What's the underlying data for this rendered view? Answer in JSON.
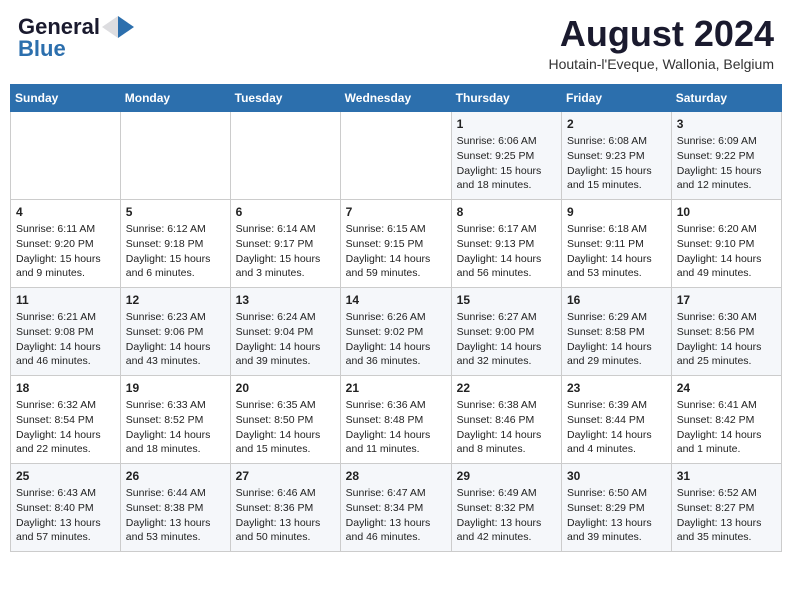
{
  "header": {
    "logo_general": "General",
    "logo_blue": "Blue",
    "month_title": "August 2024",
    "subtitle": "Houtain-l'Eveque, Wallonia, Belgium"
  },
  "weekdays": [
    "Sunday",
    "Monday",
    "Tuesday",
    "Wednesday",
    "Thursday",
    "Friday",
    "Saturday"
  ],
  "weeks": [
    [
      {
        "day": "",
        "content": ""
      },
      {
        "day": "",
        "content": ""
      },
      {
        "day": "",
        "content": ""
      },
      {
        "day": "",
        "content": ""
      },
      {
        "day": "1",
        "content": "Sunrise: 6:06 AM\nSunset: 9:25 PM\nDaylight: 15 hours\nand 18 minutes."
      },
      {
        "day": "2",
        "content": "Sunrise: 6:08 AM\nSunset: 9:23 PM\nDaylight: 15 hours\nand 15 minutes."
      },
      {
        "day": "3",
        "content": "Sunrise: 6:09 AM\nSunset: 9:22 PM\nDaylight: 15 hours\nand 12 minutes."
      }
    ],
    [
      {
        "day": "4",
        "content": "Sunrise: 6:11 AM\nSunset: 9:20 PM\nDaylight: 15 hours\nand 9 minutes."
      },
      {
        "day": "5",
        "content": "Sunrise: 6:12 AM\nSunset: 9:18 PM\nDaylight: 15 hours\nand 6 minutes."
      },
      {
        "day": "6",
        "content": "Sunrise: 6:14 AM\nSunset: 9:17 PM\nDaylight: 15 hours\nand 3 minutes."
      },
      {
        "day": "7",
        "content": "Sunrise: 6:15 AM\nSunset: 9:15 PM\nDaylight: 14 hours\nand 59 minutes."
      },
      {
        "day": "8",
        "content": "Sunrise: 6:17 AM\nSunset: 9:13 PM\nDaylight: 14 hours\nand 56 minutes."
      },
      {
        "day": "9",
        "content": "Sunrise: 6:18 AM\nSunset: 9:11 PM\nDaylight: 14 hours\nand 53 minutes."
      },
      {
        "day": "10",
        "content": "Sunrise: 6:20 AM\nSunset: 9:10 PM\nDaylight: 14 hours\nand 49 minutes."
      }
    ],
    [
      {
        "day": "11",
        "content": "Sunrise: 6:21 AM\nSunset: 9:08 PM\nDaylight: 14 hours\nand 46 minutes."
      },
      {
        "day": "12",
        "content": "Sunrise: 6:23 AM\nSunset: 9:06 PM\nDaylight: 14 hours\nand 43 minutes."
      },
      {
        "day": "13",
        "content": "Sunrise: 6:24 AM\nSunset: 9:04 PM\nDaylight: 14 hours\nand 39 minutes."
      },
      {
        "day": "14",
        "content": "Sunrise: 6:26 AM\nSunset: 9:02 PM\nDaylight: 14 hours\nand 36 minutes."
      },
      {
        "day": "15",
        "content": "Sunrise: 6:27 AM\nSunset: 9:00 PM\nDaylight: 14 hours\nand 32 minutes."
      },
      {
        "day": "16",
        "content": "Sunrise: 6:29 AM\nSunset: 8:58 PM\nDaylight: 14 hours\nand 29 minutes."
      },
      {
        "day": "17",
        "content": "Sunrise: 6:30 AM\nSunset: 8:56 PM\nDaylight: 14 hours\nand 25 minutes."
      }
    ],
    [
      {
        "day": "18",
        "content": "Sunrise: 6:32 AM\nSunset: 8:54 PM\nDaylight: 14 hours\nand 22 minutes."
      },
      {
        "day": "19",
        "content": "Sunrise: 6:33 AM\nSunset: 8:52 PM\nDaylight: 14 hours\nand 18 minutes."
      },
      {
        "day": "20",
        "content": "Sunrise: 6:35 AM\nSunset: 8:50 PM\nDaylight: 14 hours\nand 15 minutes."
      },
      {
        "day": "21",
        "content": "Sunrise: 6:36 AM\nSunset: 8:48 PM\nDaylight: 14 hours\nand 11 minutes."
      },
      {
        "day": "22",
        "content": "Sunrise: 6:38 AM\nSunset: 8:46 PM\nDaylight: 14 hours\nand 8 minutes."
      },
      {
        "day": "23",
        "content": "Sunrise: 6:39 AM\nSunset: 8:44 PM\nDaylight: 14 hours\nand 4 minutes."
      },
      {
        "day": "24",
        "content": "Sunrise: 6:41 AM\nSunset: 8:42 PM\nDaylight: 14 hours\nand 1 minute."
      }
    ],
    [
      {
        "day": "25",
        "content": "Sunrise: 6:43 AM\nSunset: 8:40 PM\nDaylight: 13 hours\nand 57 minutes."
      },
      {
        "day": "26",
        "content": "Sunrise: 6:44 AM\nSunset: 8:38 PM\nDaylight: 13 hours\nand 53 minutes."
      },
      {
        "day": "27",
        "content": "Sunrise: 6:46 AM\nSunset: 8:36 PM\nDaylight: 13 hours\nand 50 minutes."
      },
      {
        "day": "28",
        "content": "Sunrise: 6:47 AM\nSunset: 8:34 PM\nDaylight: 13 hours\nand 46 minutes."
      },
      {
        "day": "29",
        "content": "Sunrise: 6:49 AM\nSunset: 8:32 PM\nDaylight: 13 hours\nand 42 minutes."
      },
      {
        "day": "30",
        "content": "Sunrise: 6:50 AM\nSunset: 8:29 PM\nDaylight: 13 hours\nand 39 minutes."
      },
      {
        "day": "31",
        "content": "Sunrise: 6:52 AM\nSunset: 8:27 PM\nDaylight: 13 hours\nand 35 minutes."
      }
    ]
  ]
}
